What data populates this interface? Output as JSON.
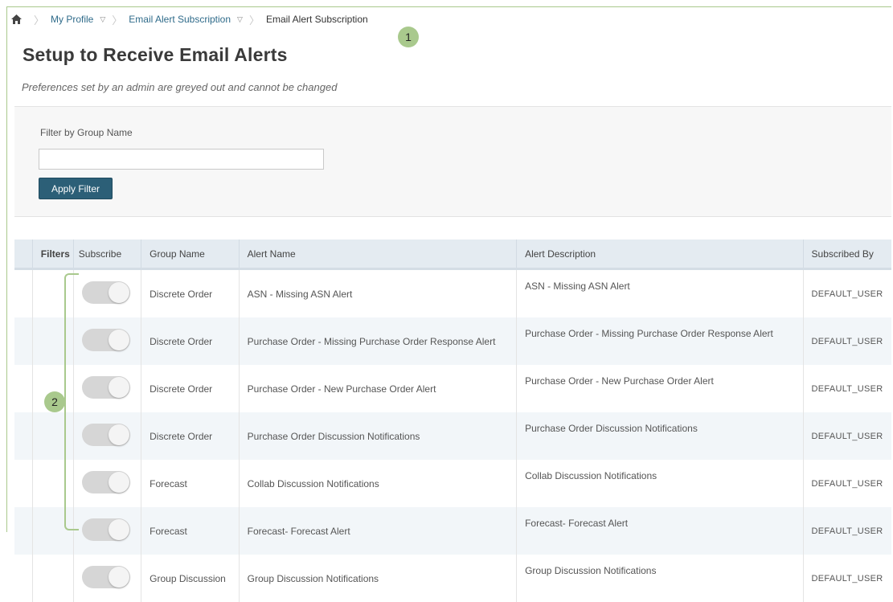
{
  "breadcrumb": {
    "items": [
      {
        "label": "My Profile"
      },
      {
        "label": "Email Alert Subscription"
      }
    ],
    "current": "Email Alert Subscription"
  },
  "callouts": [
    "1",
    "2"
  ],
  "page": {
    "title": "Setup to Receive Email Alerts",
    "subtitle": "Preferences set by an admin are greyed out and cannot be changed"
  },
  "filter": {
    "label": "Filter by Group Name",
    "value": "",
    "placeholder": "",
    "button": "Apply Filter"
  },
  "table": {
    "columns": [
      "Filters",
      "Subscribe",
      "Group Name",
      "Alert Name",
      "Alert Description",
      "Subscribed By"
    ],
    "rows": [
      {
        "group": "Discrete Order",
        "alert": "ASN - Missing ASN Alert",
        "desc": "ASN - Missing ASN Alert",
        "by": "DEFAULT_USER",
        "subscribed": false
      },
      {
        "group": "Discrete Order",
        "alert": "Purchase Order - Missing Purchase Order Response Alert",
        "desc": "Purchase Order - Missing Purchase Order Response Alert",
        "by": "DEFAULT_USER",
        "subscribed": false
      },
      {
        "group": "Discrete Order",
        "alert": "Purchase Order - New Purchase Order Alert",
        "desc": "Purchase Order - New Purchase Order Alert",
        "by": "DEFAULT_USER",
        "subscribed": false
      },
      {
        "group": "Discrete Order",
        "alert": "Purchase Order Discussion Notifications",
        "desc": "Purchase Order Discussion Notifications",
        "by": "DEFAULT_USER",
        "subscribed": false
      },
      {
        "group": "Forecast",
        "alert": "Collab Discussion Notifications",
        "desc": "Collab Discussion Notifications",
        "by": "DEFAULT_USER",
        "subscribed": false
      },
      {
        "group": "Forecast",
        "alert": "Forecast- Forecast Alert",
        "desc": "Forecast- Forecast Alert",
        "by": "DEFAULT_USER",
        "subscribed": false
      },
      {
        "group": "Group Discussion",
        "alert": "Group Discussion Notifications",
        "desc": "Group Discussion Notifications",
        "by": "DEFAULT_USER",
        "subscribed": false
      }
    ]
  },
  "colors": {
    "accent": "#2c5f77",
    "callout": "#a9c98d",
    "header_bg": "#e4ebf1",
    "toggle_off": "#d6d6d6"
  }
}
